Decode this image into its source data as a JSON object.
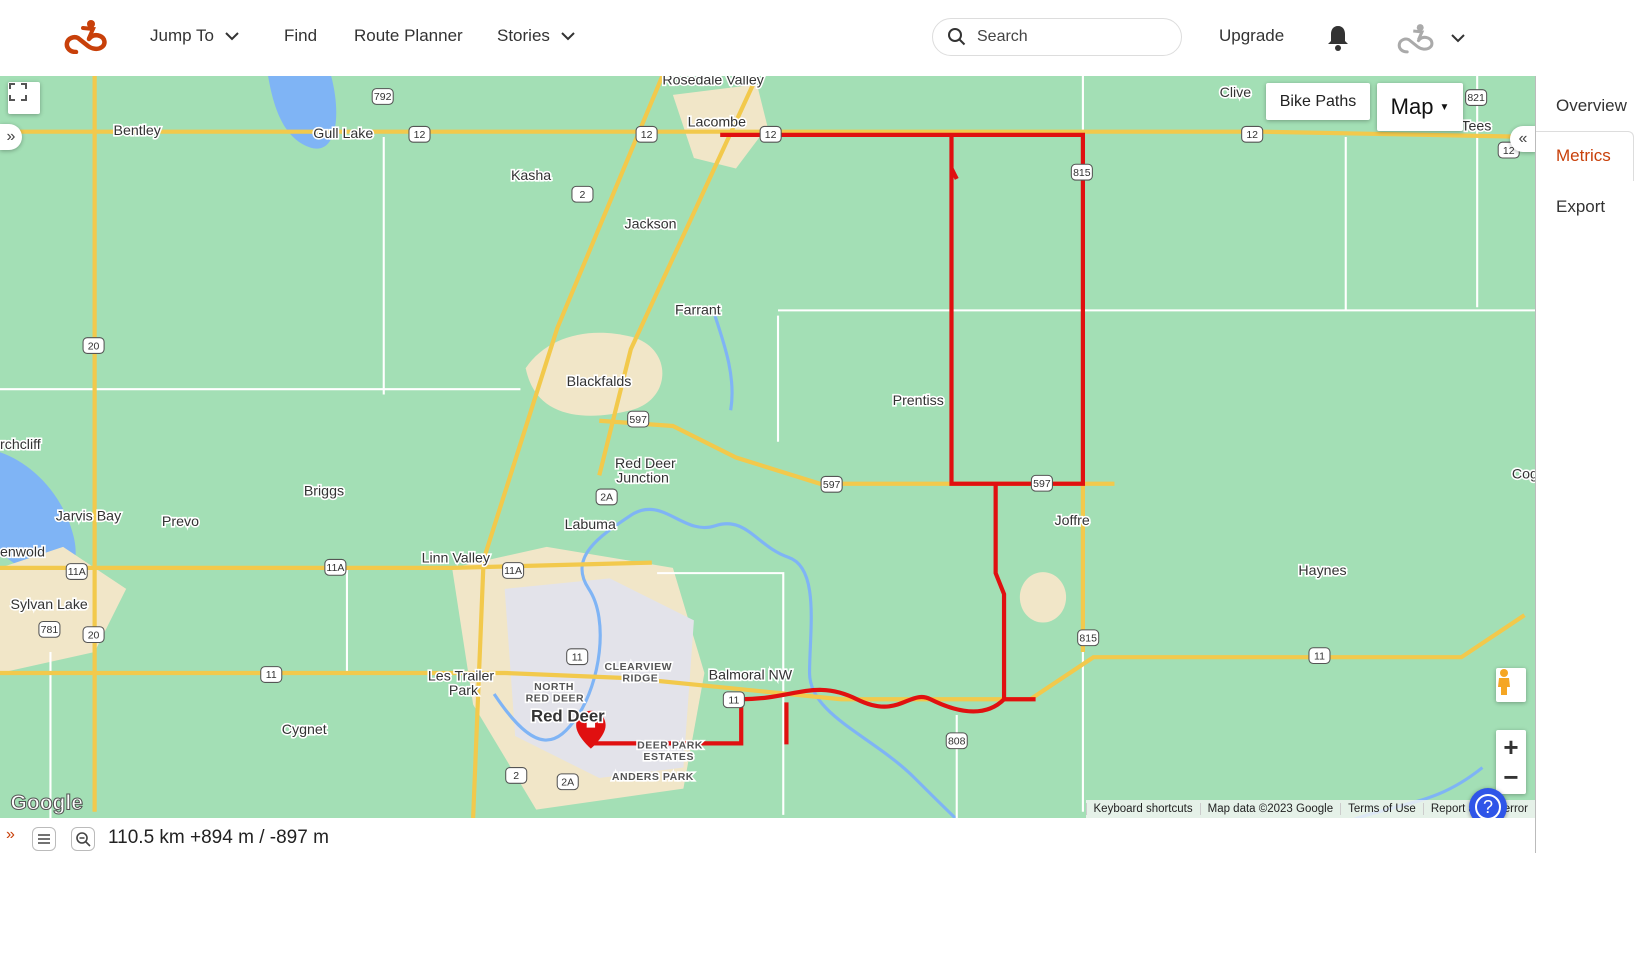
{
  "header": {
    "nav": [
      {
        "label": "Jump To",
        "has_dropdown": true
      },
      {
        "label": "Find"
      },
      {
        "label": "Route Planner"
      },
      {
        "label": "Stories",
        "has_dropdown": true
      }
    ],
    "search_placeholder": "Search",
    "upgrade_label": "Upgrade",
    "icons": [
      "ride-logo-icon",
      "search-icon",
      "bell-icon",
      "avatar-cyclist-icon",
      "chevron-down-icon"
    ]
  },
  "map": {
    "bike_paths_label": "Bike Paths",
    "map_type_label": "Map",
    "attribution": [
      "Keyboard shortcuts",
      "Map data ©2023 Google",
      "Terms of Use",
      "Report a map error"
    ],
    "google_logo": "Google",
    "places": [
      "Rosedale Valley",
      "Lacombe",
      "Bentley",
      "Gull Lake",
      "Kasha",
      "Jackson",
      "Farrant",
      "Blackfalds",
      "Prentiss",
      "Red Deer",
      "Junction",
      "Briggs",
      "Jarvis Bay",
      "Prevo",
      "Labuma",
      "Linn Valley",
      "Sylvan Lake",
      "Les Trailer",
      "Park",
      "Cygnet",
      "NORTH",
      "RED DEER",
      "CLEARVIEW",
      "RIDGE",
      "Balmoral NW",
      "Red Deer",
      "DEER PARK",
      "ESTATES",
      "ANDERS PARK",
      "Joffre",
      "Haynes",
      "Clive",
      "Tees",
      "rchcliff",
      "enwold",
      "Cog"
    ],
    "shields": [
      "792",
      "12",
      "12",
      "12",
      "12",
      "12",
      "2",
      "20",
      "20",
      "597",
      "597",
      "597",
      "2A",
      "2A",
      "11A",
      "11A",
      "11A",
      "11",
      "11",
      "11",
      "11",
      "781",
      "815",
      "815",
      "808",
      "2",
      "821"
    ],
    "route_color": "#e01010"
  },
  "side_tabs": [
    {
      "label": "Overview"
    },
    {
      "label": "Metrics",
      "active": true
    },
    {
      "label": "Export"
    }
  ],
  "accent_color": "#c8400a",
  "bottom": {
    "stats": "110.5 km +894 m / -897 m"
  }
}
